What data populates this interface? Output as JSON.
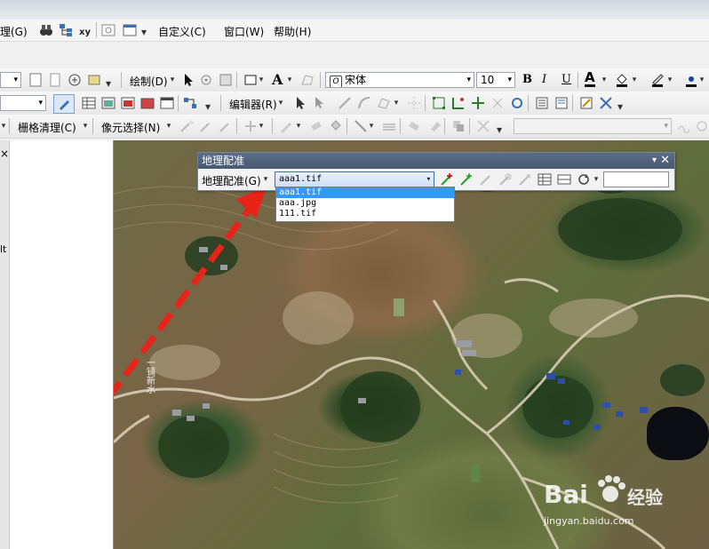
{
  "menubar": {
    "items": [
      "理(G)",
      "自定义(C)",
      "窗口(W)",
      "帮助(H)"
    ]
  },
  "toolbar2": {
    "draw_label": "绘制(D)",
    "font_name": "宋体",
    "font_size": "10",
    "bold": "B",
    "italic": "I",
    "underline": "U",
    "text_a": "A"
  },
  "toolbar3": {
    "editor_label": "编辑器(R)"
  },
  "toolbar4": {
    "raster_cleanup_label": "栅格清理(C)",
    "pixel_select_label": "像元选择(N)"
  },
  "left_panel": {
    "close_glyph": "×",
    "side_text": "lt"
  },
  "georeferencing": {
    "title": "地理配准",
    "menu_label": "地理配准(G)",
    "layer_value": "aaa1.tif",
    "layers": [
      "aaa1.tif",
      "aaa.jpg",
      "111.tif"
    ],
    "selected_index": 0,
    "input_value": ""
  },
  "map_labels": {
    "vertical_text": "一铺新水"
  },
  "watermark": {
    "brand": "Bai",
    "brand2": "经验",
    "url": "jingyan.baidu.com"
  },
  "colors": {
    "accent": "#3399ff",
    "arrow": "#e8231a",
    "title_bar": "#485a72"
  }
}
